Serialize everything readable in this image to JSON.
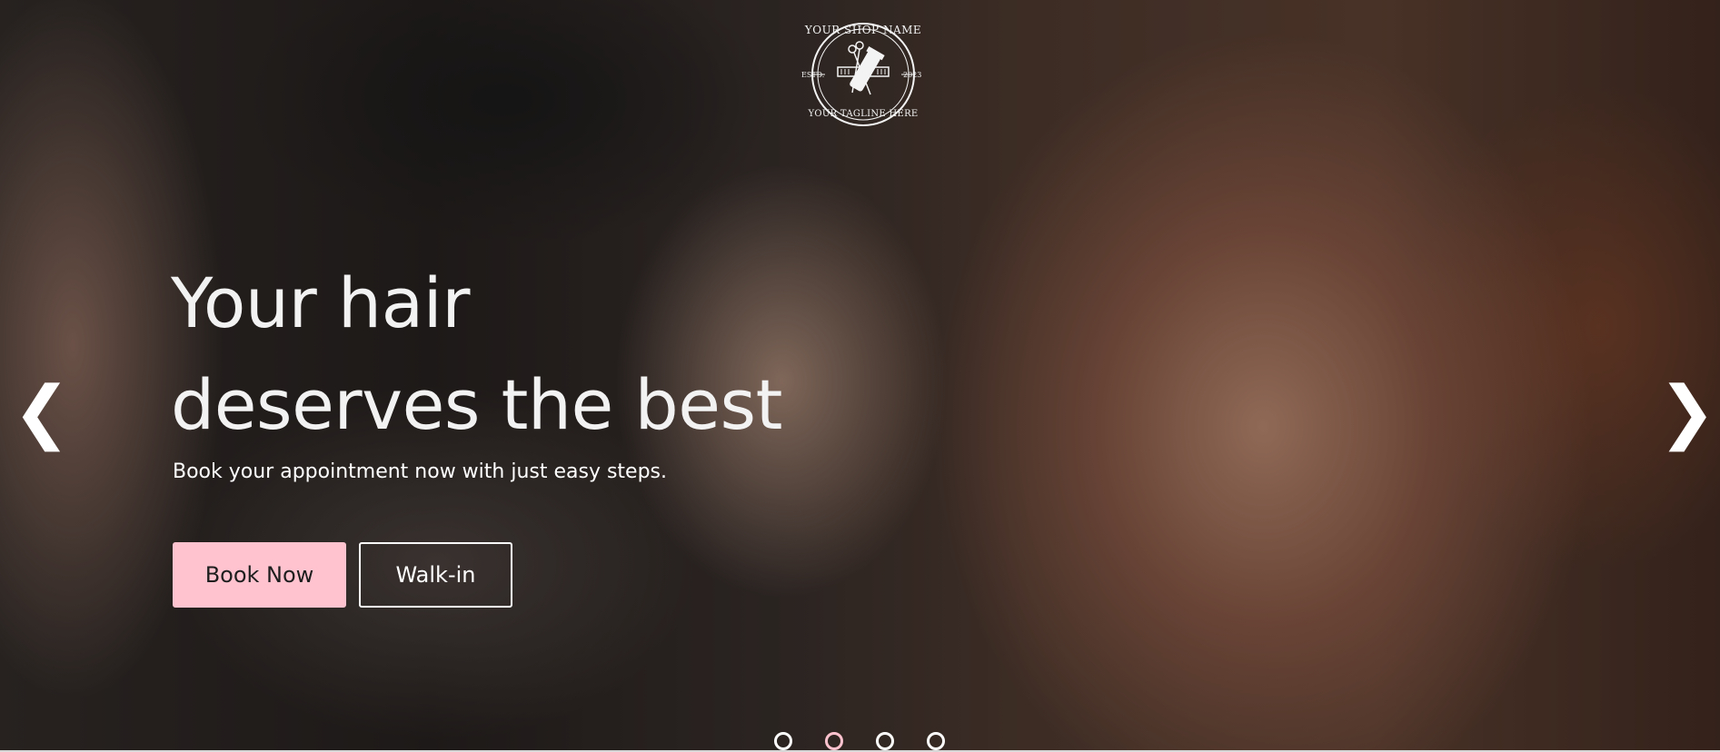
{
  "logo": {
    "shop_name": "YOUR SHOP NAME",
    "tagline": "YOUR TAGLINE HERE",
    "estd": "ESTD.",
    "year": "2023"
  },
  "hero": {
    "headline_line1": "Your hair",
    "headline_line2": "deserves the best",
    "subtitle": "Book your appointment now with just easy steps.",
    "book_label": "Book Now",
    "walkin_label": "Walk-in"
  },
  "carousel": {
    "prev": "❮",
    "next": "❯",
    "slides": 4,
    "active_slide": 2
  },
  "colors": {
    "accent": "#ffc3cf",
    "text": "#ffffff"
  }
}
